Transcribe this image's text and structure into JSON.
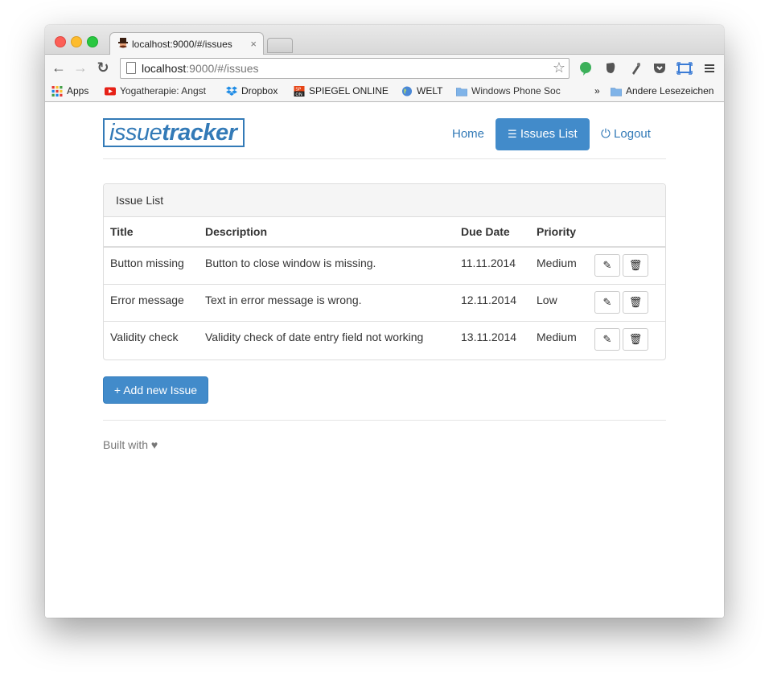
{
  "browser": {
    "tab_title": "localhost:9000/#/issues",
    "tab_close": "×",
    "url_host": "localhost",
    "url_path": ":9000/#/issues",
    "bookmarks": [
      {
        "label": "Apps",
        "icon": "apps-grid-icon"
      },
      {
        "label": "Yogatherapie: Angst",
        "icon": "youtube-icon"
      },
      {
        "label": "Dropbox",
        "icon": "dropbox-icon"
      },
      {
        "label": "SPIEGEL ONLINE",
        "icon": "spiegel-icon"
      },
      {
        "label": "WELT",
        "icon": "globe-icon"
      },
      {
        "label": "Windows Phone Soc",
        "icon": "folder-icon"
      }
    ],
    "bookmarks_more": "»",
    "bookmark_other": "Andere Lesezeichen"
  },
  "app": {
    "logo_light": "issue",
    "logo_bold": "tracker",
    "nav": {
      "home": "Home",
      "issues": "Issues List",
      "logout": "Logout"
    },
    "panel_title": "Issue List",
    "columns": [
      "Title",
      "Description",
      "Due Date",
      "Priority"
    ],
    "issues": [
      {
        "title": "Button missing",
        "description": "Button to close window is missing.",
        "due": "11.11.2014",
        "priority": "Medium"
      },
      {
        "title": "Error message",
        "description": "Text in error message is wrong.",
        "due": "12.11.2014",
        "priority": "Low"
      },
      {
        "title": "Validity check",
        "description": "Validity check of date entry field not working",
        "due": "13.11.2014",
        "priority": "Medium"
      }
    ],
    "add_button": "+ Add new Issue",
    "footer_text": "Built with"
  },
  "colors": {
    "primary": "#428bca",
    "link": "#337ab7"
  }
}
